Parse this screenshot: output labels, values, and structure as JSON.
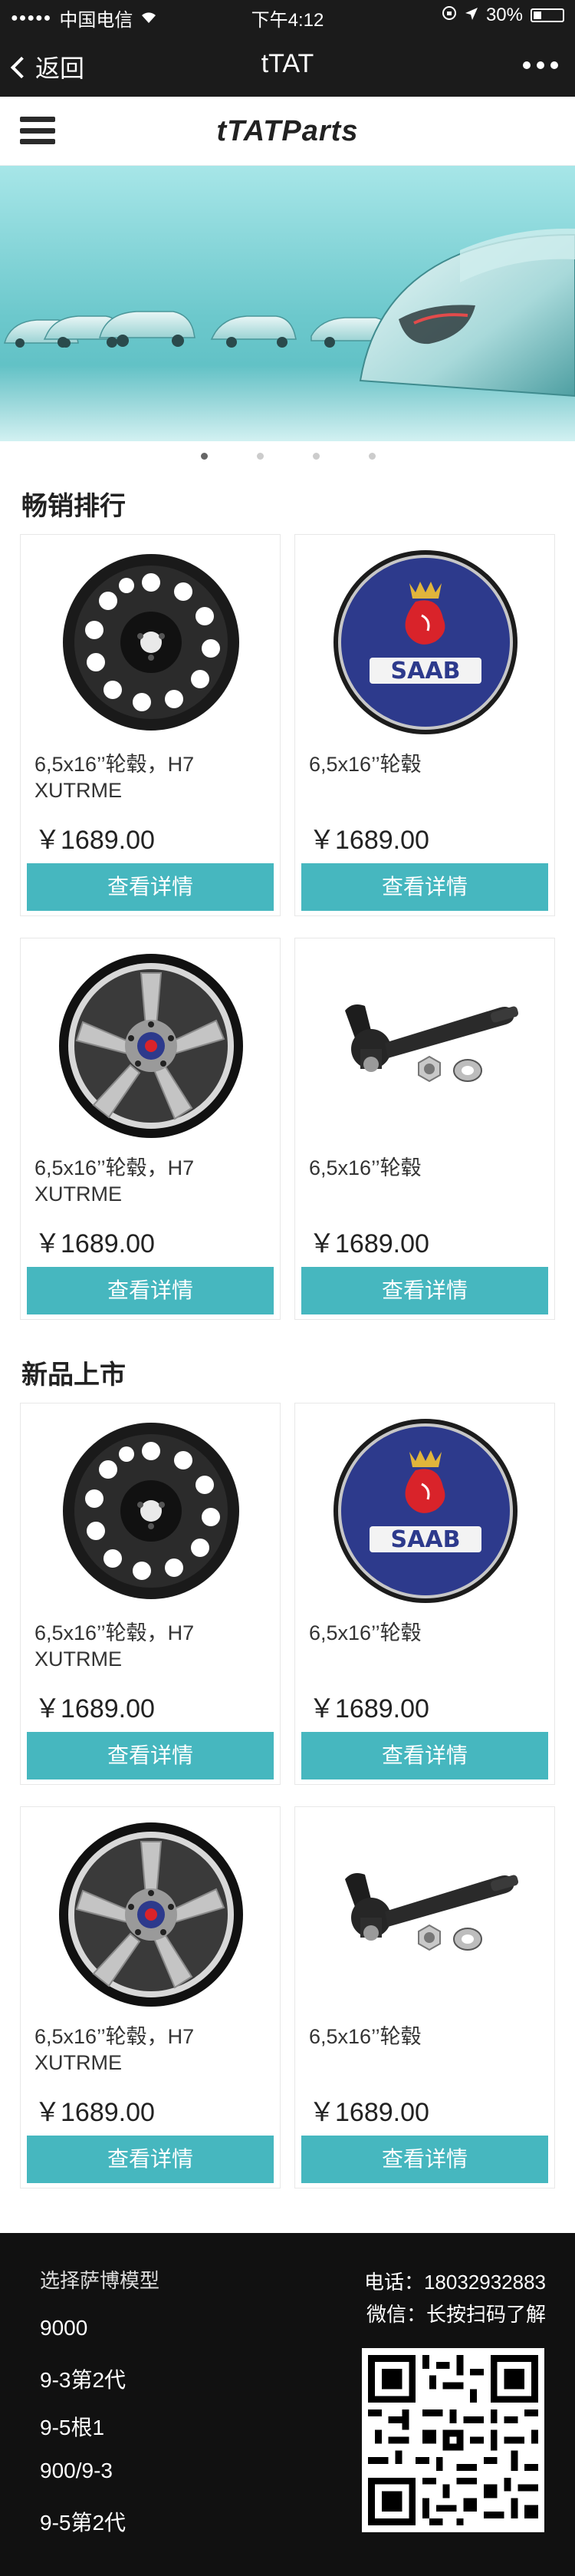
{
  "status_bar": {
    "carrier": "中国电信",
    "time": "下午4:12",
    "battery": "30%"
  },
  "nav": {
    "back_label": "返回",
    "title": "tTAT"
  },
  "header": {
    "logo": "tTATParts"
  },
  "banner": {
    "slides": 4,
    "active_index": 0
  },
  "sections": [
    {
      "title": "畅销排行",
      "products": [
        {
          "name": "6,5x16’’轮毂，H7 XUTRME",
          "price": "￥1689.00",
          "button": "查看详情",
          "image": "black-steel-wheel-icon"
        },
        {
          "name": "6,5x16’’轮毂",
          "price": "￥1689.00",
          "button": "查看详情",
          "image": "saab-emblem-icon"
        },
        {
          "name": "6,5x16’’轮毂，H7 XUTRME",
          "price": "￥1689.00",
          "button": "查看详情",
          "image": "alloy-wheel-icon"
        },
        {
          "name": "6,5x16’’轮毂",
          "price": "￥1689.00",
          "button": "查看详情",
          "image": "tie-rod-end-icon"
        }
      ]
    },
    {
      "title": "新品上市",
      "products": [
        {
          "name": "6,5x16’’轮毂，H7 XUTRME",
          "price": "￥1689.00",
          "button": "查看详情",
          "image": "black-steel-wheel-icon"
        },
        {
          "name": "6,5x16’’轮毂",
          "price": "￥1689.00",
          "button": "查看详情",
          "image": "saab-emblem-icon"
        },
        {
          "name": "6,5x16’’轮毂，H7 XUTRME",
          "price": "￥1689.00",
          "button": "查看详情",
          "image": "alloy-wheel-icon"
        },
        {
          "name": "6,5x16’’轮毂",
          "price": "￥1689.00",
          "button": "查看详情",
          "image": "tie-rod-end-icon"
        }
      ]
    }
  ],
  "footer": {
    "models_title": "选择萨博模型",
    "models": [
      "9000",
      "9-3第2代",
      "9-5根1",
      "900/9-3",
      "9-5第2代"
    ],
    "phone": "电话：18032932883",
    "wechat": "微信：长按扫码了解"
  },
  "colors": {
    "accent": "#46b7bf",
    "dark": "#1b1b1b"
  }
}
